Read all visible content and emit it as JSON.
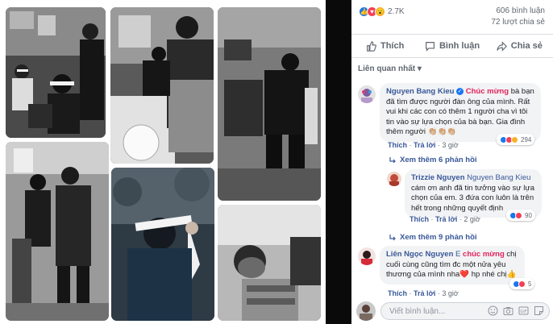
{
  "post": {
    "reaction_count": "2.7K",
    "comment_count": "606 bình luận",
    "share_count": "72 lượt chia sẻ"
  },
  "actions": {
    "like": "Thích",
    "comment": "Bình luận",
    "share": "Chia sẻ"
  },
  "filter_label": "Liên quan nhất",
  "comments": [
    {
      "author": "Nguyen Bang Kieu",
      "highlight": "Chúc mừng",
      "text": "bà bạn đã tìm được người đàn ông của mình. Rất vui khi các con có thêm 1 người cha vì tôi tin vào sự lựa chọn của bà bạn. Gia đình thêm người 👏🏼👏🏼👏🏼",
      "like": "Thích",
      "reply": "Trả lời",
      "time": "3 giờ",
      "reactions": "294",
      "more_replies": "Xem thêm 6 phản hồi"
    },
    {
      "author": "Trizzie Nguyen",
      "tag": "Nguyen Bang Kieu",
      "text": "cám ơn anh đã tin tưởng vào sự lựa chọn của em. 3 đứa con luôn là trên hết trong những quyết định",
      "like": "Thích",
      "reply": "Trả lời",
      "time": "2 giờ",
      "reactions": "90",
      "more_replies": "Xem thêm 9 phản hồi"
    },
    {
      "author": "Liên Ngọc Nguyen",
      "tag": "E",
      "highlight": "chúc mừng",
      "text": "chị cuối cùng cũng tìm đc một nửa yêu thương của mình nha❤️ hp nhé chị👍",
      "like": "Thích",
      "reply": "Trả lời",
      "time": "3 giờ",
      "reactions": "5"
    }
  ],
  "composer": {
    "placeholder": "Viết bình luận..."
  },
  "colors": {
    "link": "#385898",
    "like_blue": "#1877f2",
    "love_red": "#f33e58",
    "haha_yellow": "#f7b125",
    "highlight_pink": "#e0245e"
  }
}
